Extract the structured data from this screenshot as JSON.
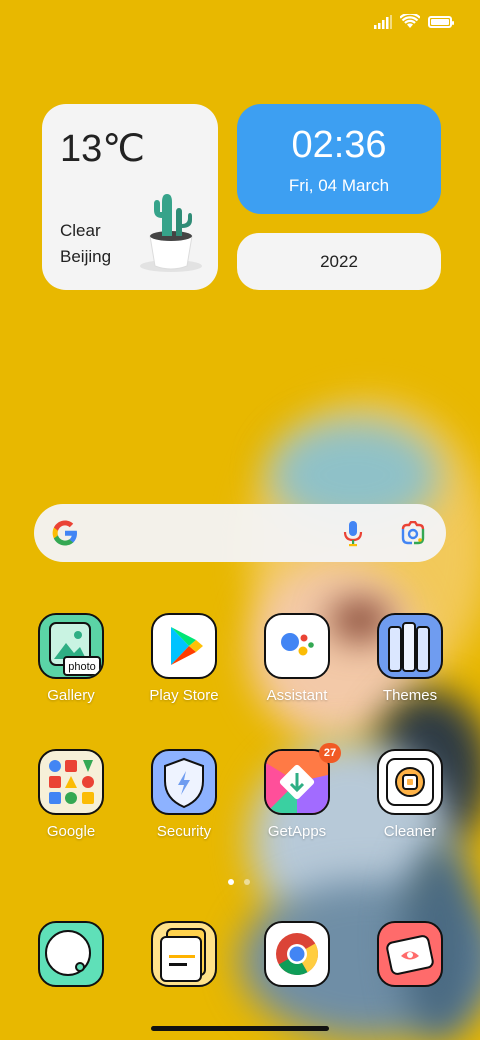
{
  "status_bar": {
    "battery_level": 1.0
  },
  "weather": {
    "temperature": "13℃",
    "condition": "Clear",
    "city": "Beijing"
  },
  "clock": {
    "time": "02:36",
    "date": "Fri, 04 March"
  },
  "year_widget": {
    "year": "2022"
  },
  "search": {
    "placeholder": ""
  },
  "apps_row1": [
    {
      "label": "Gallery"
    },
    {
      "label": "Play Store"
    },
    {
      "label": "Assistant"
    },
    {
      "label": "Themes"
    }
  ],
  "apps_row2": [
    {
      "label": "Google"
    },
    {
      "label": "Security"
    },
    {
      "label": "GetApps",
      "badge": "27"
    },
    {
      "label": "Cleaner"
    }
  ],
  "gallery_icon_text": "photo",
  "page_indicator": {
    "current": 1,
    "total": 2
  },
  "colors": {
    "wallpaper": "#e8b800",
    "clock_widget": "#3d9ff2",
    "badge": "#f15a24"
  }
}
